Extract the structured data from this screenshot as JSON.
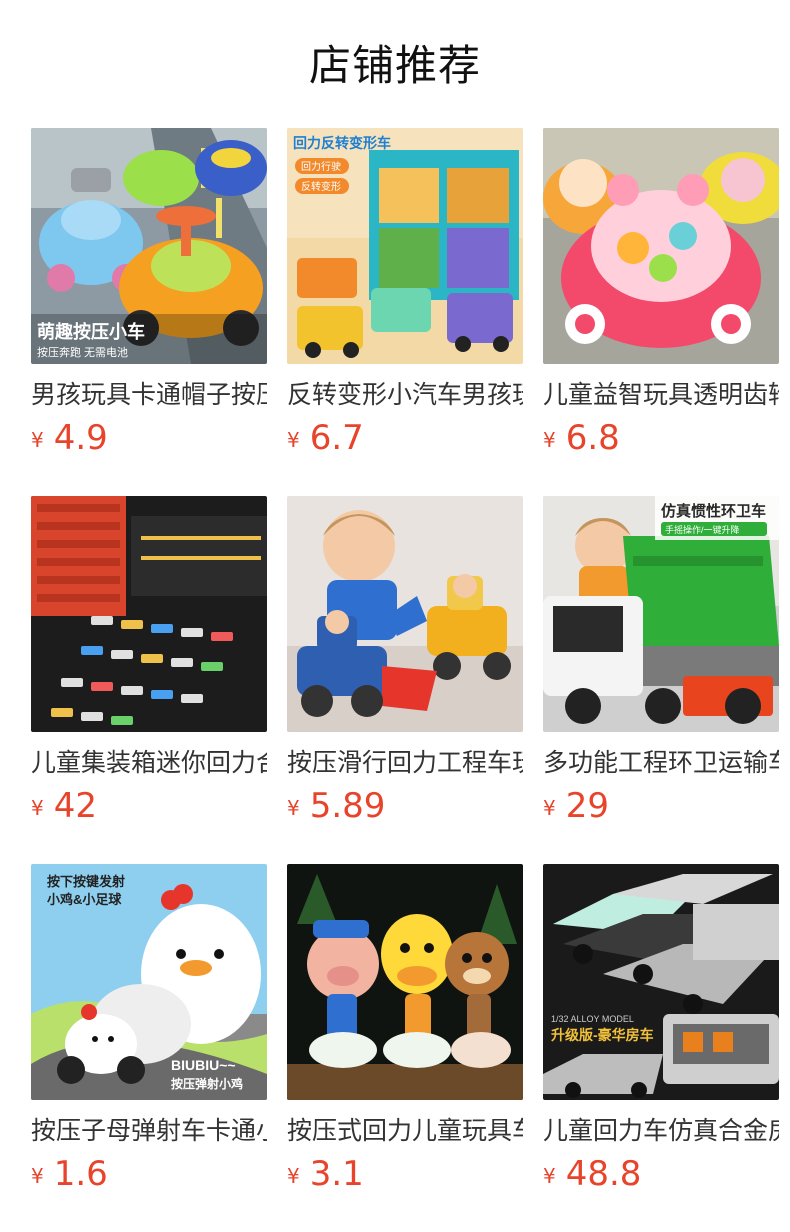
{
  "page": {
    "title": "店铺推荐"
  },
  "colors": {
    "price": "#e8442b",
    "title": "#111111"
  },
  "products": [
    {
      "name": "男孩玩具卡通帽子按压小车",
      "currency": "¥",
      "price": "4.9",
      "image_icon": "toy-car-hat-image",
      "caption_main": "萌趣按压小车",
      "caption_sub": "按压奔跑 无需电池"
    },
    {
      "name": "反转变形小汽车男孩玩具",
      "currency": "¥",
      "price": "6.7",
      "image_icon": "transforming-car-image",
      "caption_main": "回力反转变形车",
      "badge1": "回力行驶",
      "badge2": "反转变形"
    },
    {
      "name": "儿童益智玩具透明齿轮车",
      "currency": "¥",
      "price": "6.8",
      "image_icon": "gear-car-image"
    },
    {
      "name": "儿童集装箱迷你回力合金车",
      "currency": "¥",
      "price": "42",
      "image_icon": "container-truck-image"
    },
    {
      "name": "按压滑行回力工程车玩具",
      "currency": "¥",
      "price": "5.89",
      "image_icon": "excavator-toy-image"
    },
    {
      "name": "多功能工程环卫运输车玩具",
      "currency": "¥",
      "price": "29",
      "image_icon": "garbage-truck-image",
      "caption_main": "仿真惯性环卫车",
      "caption_sub": "手摇操作/一键升降"
    },
    {
      "name": "按压子母弹射车卡通小鸡",
      "currency": "¥",
      "price": "1.6",
      "image_icon": "chicken-launcher-image",
      "caption_main": "按下按键发射",
      "caption_main2": "小鸡&小足球",
      "caption_sub": "BIUBIU~~",
      "caption_sub2": "按压弹射小鸡"
    },
    {
      "name": "按压式回力儿童玩具车",
      "currency": "¥",
      "price": "3.1",
      "image_icon": "animal-scooter-image"
    },
    {
      "name": "儿童回力车仿真合金房车",
      "currency": "¥",
      "price": "48.8",
      "image_icon": "rv-trailer-image",
      "caption_main": "升级版-豪华房车",
      "caption_sub": "1/32 ALLOY MODEL"
    }
  ]
}
